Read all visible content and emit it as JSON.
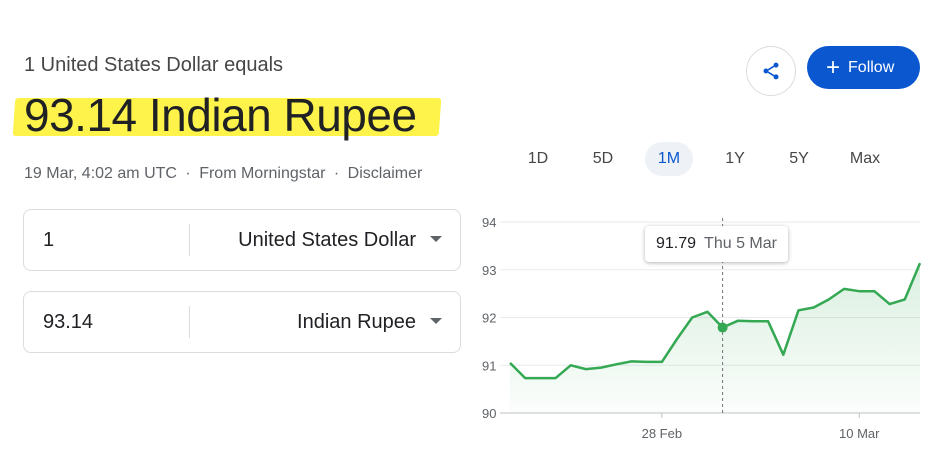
{
  "header": {
    "subtitle": "1 United States Dollar equals",
    "value": "93.14 Indian Rupee",
    "date": "19 Mar, 4:02 am UTC",
    "source": "From Morningstar",
    "disclaimer": "Disclaimer",
    "separator": "·"
  },
  "converter": {
    "from": {
      "amount": "1",
      "currency": "United States Dollar"
    },
    "to": {
      "amount": "93.14",
      "currency": "Indian Rupee"
    }
  },
  "actions": {
    "share_icon": "share-icon",
    "follow_label": "Follow",
    "follow_icon": "plus-icon"
  },
  "colors": {
    "accent": "#0b57d0",
    "highlight": "#fdf34a",
    "line": "#34a853"
  },
  "ranges": {
    "items": [
      "1D",
      "5D",
      "1M",
      "1Y",
      "5Y",
      "Max"
    ],
    "selected": "1M"
  },
  "tooltip": {
    "value": "91.79",
    "date": "Thu 5 Mar"
  },
  "chart_data": {
    "type": "area",
    "y_ticks": [
      "94",
      "93",
      "92",
      "91",
      "90"
    ],
    "ylim": [
      90,
      94
    ],
    "x_tick_labels": [
      "28 Feb",
      "10 Mar"
    ],
    "x": [
      0,
      1,
      2,
      3,
      4,
      5,
      6,
      7,
      8,
      9,
      10,
      11,
      12,
      13,
      14,
      15,
      16,
      17,
      18,
      19,
      20,
      21,
      22,
      23,
      24,
      25,
      26,
      27,
      28,
      29,
      30,
      31,
      32,
      33
    ],
    "values": [
      91.05,
      90.73,
      90.73,
      90.73,
      91.0,
      90.92,
      90.95,
      91.02,
      91.08,
      91.07,
      91.07,
      91.55,
      92.0,
      92.12,
      91.79,
      91.93,
      91.92,
      91.92,
      91.22,
      92.15,
      92.21,
      92.38,
      92.6,
      92.55,
      92.55,
      92.28,
      92.38,
      93.14
    ],
    "highlight_index": 14,
    "x_tick_positions": [
      10,
      23
    ]
  }
}
